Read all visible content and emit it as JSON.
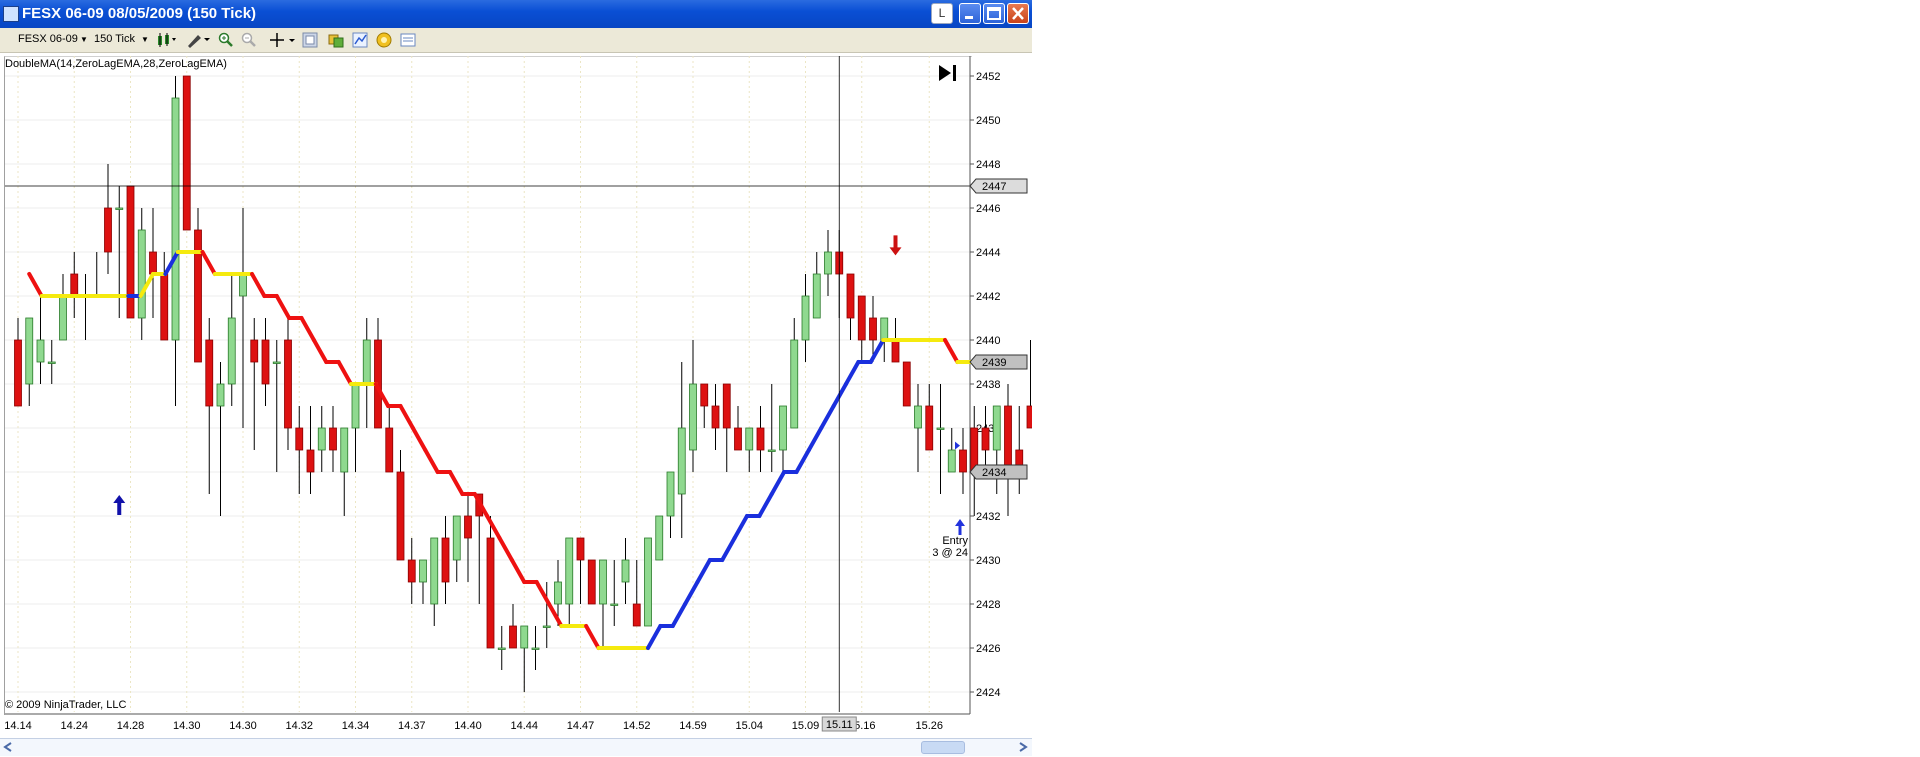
{
  "window": {
    "title": "FESX 06-09  08/05/2009 (150 Tick)",
    "close_tooltip_letter": "L"
  },
  "toolbar": {
    "instrument": "FESX 06-09",
    "interval": "150 Tick",
    "icons": [
      "candlestick-style-icon",
      "draw-tool-icon",
      "zoom-in-icon",
      "zoom-out-icon",
      "crosshair-icon",
      "properties-icon",
      "strategies-icon",
      "indicators-icon",
      "data-box-icon",
      "chart-properties-icon"
    ]
  },
  "chart": {
    "indicator_label": "DoubleMA(14,ZeroLagEMA,28,ZeroLagEMA)",
    "copyright": "© 2009 NinjaTrader, LLC",
    "crosshair_price_label": "2447",
    "last_price_label": "2439",
    "marker_price_label": "2434",
    "entry_label_1": "Entry",
    "entry_label_2": "3 @ 24",
    "crosshair_time_label": "15.11",
    "colors": {
      "up": "#8fd98f",
      "down": "#dd1111",
      "ma_down": "#ee1111",
      "ma_flat": "#f5ea0e",
      "ma_up": "#1a2fdd",
      "arrow_buy": "#1111aa",
      "arrow_sell": "#cc1111"
    }
  },
  "chart_data": {
    "type": "candlestick",
    "title": "",
    "ylim": [
      2423.5,
      2453
    ],
    "y_ticks": [
      2424,
      2426,
      2428,
      2430,
      2432,
      2434,
      2436,
      2438,
      2440,
      2442,
      2444,
      2446,
      2448,
      2450,
      2452
    ],
    "x_ticks": [
      "14.14",
      "14.24",
      "14.28",
      "14.30",
      "14.30",
      "14.32",
      "14.34",
      "14.37",
      "14.40",
      "14.44",
      "14.47",
      "14.52",
      "14.59",
      "15.04",
      "15.09",
      "15.16",
      "15.26"
    ],
    "x_tick_bar_index": [
      0,
      5,
      10,
      15,
      20,
      25,
      30,
      35,
      40,
      45,
      50,
      55,
      60,
      65,
      70,
      75,
      81
    ],
    "candles": [
      [
        2440,
        2441,
        2437,
        2437
      ],
      [
        2438,
        2441,
        2437,
        2441
      ],
      [
        2439,
        2442,
        2438,
        2440
      ],
      [
        2439,
        2440,
        2438,
        2439
      ],
      [
        2440,
        2443,
        2440,
        2442
      ],
      [
        2443,
        2444,
        2441,
        2442
      ],
      [
        2442,
        2443,
        2440,
        2442
      ],
      [
        2442,
        2444,
        2442,
        2442
      ],
      [
        2446,
        2448,
        2443,
        2444
      ],
      [
        2446,
        2447,
        2441,
        2446
      ],
      [
        2447,
        2447,
        2441,
        2441
      ],
      [
        2441,
        2446,
        2440,
        2445
      ],
      [
        2444,
        2446,
        2441,
        2443
      ],
      [
        2443,
        2444,
        2440,
        2440
      ],
      [
        2440,
        2452,
        2437,
        2451
      ],
      [
        2452,
        2452,
        2445,
        2445
      ],
      [
        2445,
        2446,
        2439,
        2439
      ],
      [
        2440,
        2441,
        2433,
        2437
      ],
      [
        2437,
        2439,
        2432,
        2438
      ],
      [
        2438,
        2443,
        2437,
        2441
      ],
      [
        2442,
        2446,
        2436,
        2443
      ],
      [
        2440,
        2441,
        2435,
        2439
      ],
      [
        2440,
        2441,
        2437,
        2438
      ],
      [
        2439,
        2440,
        2434,
        2439
      ],
      [
        2440,
        2441,
        2435,
        2436
      ],
      [
        2436,
        2437,
        2433,
        2435
      ],
      [
        2435,
        2437,
        2433,
        2434
      ],
      [
        2435,
        2437,
        2434,
        2436
      ],
      [
        2436,
        2437,
        2434,
        2435
      ],
      [
        2434,
        2436,
        2432,
        2436
      ],
      [
        2436,
        2438,
        2434,
        2438
      ],
      [
        2438,
        2441,
        2436,
        2440
      ],
      [
        2440,
        2441,
        2436,
        2436
      ],
      [
        2436,
        2437,
        2434,
        2434
      ],
      [
        2434,
        2435,
        2430,
        2430
      ],
      [
        2430,
        2431,
        2428,
        2429
      ],
      [
        2429,
        2430,
        2428,
        2430
      ],
      [
        2428,
        2431,
        2427,
        2431
      ],
      [
        2431,
        2432,
        2428,
        2429
      ],
      [
        2430,
        2432,
        2429,
        2432
      ],
      [
        2432,
        2433,
        2429,
        2431
      ],
      [
        2433,
        2433,
        2428,
        2432
      ],
      [
        2431,
        2432,
        2426,
        2426
      ],
      [
        2426,
        2427,
        2425,
        2426
      ],
      [
        2427,
        2428,
        2426,
        2426
      ],
      [
        2426,
        2427,
        2424,
        2427
      ],
      [
        2426,
        2427,
        2425,
        2426
      ],
      [
        2427,
        2429,
        2426,
        2427
      ],
      [
        2428,
        2430,
        2427,
        2429
      ],
      [
        2428,
        2431,
        2427,
        2431
      ],
      [
        2431,
        2431,
        2428,
        2430
      ],
      [
        2430,
        2430,
        2428,
        2428
      ],
      [
        2428,
        2430,
        2426,
        2430
      ],
      [
        2428,
        2430,
        2427,
        2428
      ],
      [
        2429,
        2431,
        2428,
        2430
      ],
      [
        2428,
        2430,
        2427,
        2427
      ],
      [
        2427,
        2431,
        2427,
        2431
      ],
      [
        2430,
        2432,
        2430,
        2432
      ],
      [
        2432,
        2434,
        2431,
        2434
      ],
      [
        2433,
        2439,
        2431,
        2436
      ],
      [
        2435,
        2440,
        2434,
        2438
      ],
      [
        2438,
        2438,
        2436,
        2437
      ],
      [
        2437,
        2438,
        2435,
        2436
      ],
      [
        2438,
        2438,
        2434,
        2436
      ],
      [
        2436,
        2437,
        2435,
        2435
      ],
      [
        2435,
        2436,
        2434,
        2436
      ],
      [
        2436,
        2437,
        2434,
        2435
      ],
      [
        2435,
        2438,
        2434,
        2435
      ],
      [
        2435,
        2437,
        2434,
        2437
      ],
      [
        2436,
        2441,
        2436,
        2440
      ],
      [
        2440,
        2443,
        2439,
        2442
      ],
      [
        2441,
        2444,
        2441,
        2443
      ],
      [
        2443,
        2445,
        2442,
        2444
      ],
      [
        2444,
        2445,
        2441,
        2443
      ],
      [
        2443,
        2443,
        2440,
        2441
      ],
      [
        2442,
        2442,
        2439,
        2440
      ],
      [
        2441,
        2442,
        2439,
        2440
      ],
      [
        2440,
        2441,
        2439,
        2441
      ],
      [
        2440,
        2441,
        2439,
        2439
      ],
      [
        2439,
        2439,
        2437,
        2437
      ],
      [
        2436,
        2438,
        2434,
        2437
      ],
      [
        2437,
        2438,
        2435,
        2435
      ],
      [
        2436,
        2438,
        2433,
        2436
      ],
      [
        2434,
        2436,
        2434,
        2435
      ],
      [
        2435,
        2436,
        2433,
        2434
      ],
      [
        2436,
        2437,
        2432,
        2434
      ],
      [
        2436,
        2437,
        2434,
        2435
      ],
      [
        2435,
        2437,
        2433,
        2437
      ],
      [
        2437,
        2438,
        2432,
        2434
      ],
      [
        2435,
        2437,
        2433,
        2434
      ],
      [
        2437,
        2440,
        2436,
        2436
      ],
      [
        2438,
        2439,
        2433,
        2434
      ]
    ],
    "ma_points": [
      [
        2443,
        "down"
      ],
      [
        2442,
        "down"
      ],
      [
        2442,
        "flat"
      ],
      [
        2442,
        "flat"
      ],
      [
        2442,
        "flat"
      ],
      [
        2442,
        "flat"
      ],
      [
        2442,
        "flat"
      ],
      [
        2442,
        "flat"
      ],
      [
        2442,
        "flat"
      ],
      [
        2442,
        "up"
      ],
      [
        2443,
        "flat"
      ],
      [
        2443,
        "flat"
      ],
      [
        2444,
        "up"
      ],
      [
        2444,
        "flat"
      ],
      [
        2444,
        "flat"
      ],
      [
        2443,
        "down"
      ],
      [
        2443,
        "flat"
      ],
      [
        2443,
        "flat"
      ],
      [
        2443,
        "flat"
      ],
      [
        2442,
        "down"
      ],
      [
        2442,
        "down"
      ],
      [
        2441,
        "down"
      ],
      [
        2441,
        "down"
      ],
      [
        2440,
        "down"
      ],
      [
        2439,
        "down"
      ],
      [
        2439,
        "down"
      ],
      [
        2438,
        "down"
      ],
      [
        2438,
        "flat"
      ],
      [
        2438,
        "flat"
      ],
      [
        2437,
        "down"
      ],
      [
        2437,
        "down"
      ],
      [
        2436,
        "down"
      ],
      [
        2435,
        "down"
      ],
      [
        2434,
        "down"
      ],
      [
        2434,
        "down"
      ],
      [
        2433,
        "down"
      ],
      [
        2433,
        "down"
      ],
      [
        2432,
        "down"
      ],
      [
        2431,
        "down"
      ],
      [
        2430,
        "down"
      ],
      [
        2429,
        "down"
      ],
      [
        2429,
        "down"
      ],
      [
        2428,
        "down"
      ],
      [
        2427,
        "down"
      ],
      [
        2427,
        "flat"
      ],
      [
        2427,
        "flat"
      ],
      [
        2426,
        "down"
      ],
      [
        2426,
        "flat"
      ],
      [
        2426,
        "flat"
      ],
      [
        2426,
        "flat"
      ],
      [
        2426,
        "flat"
      ],
      [
        2427,
        "up"
      ],
      [
        2427,
        "up"
      ],
      [
        2428,
        "up"
      ],
      [
        2429,
        "up"
      ],
      [
        2430,
        "up"
      ],
      [
        2430,
        "up"
      ],
      [
        2431,
        "up"
      ],
      [
        2432,
        "up"
      ],
      [
        2432,
        "up"
      ],
      [
        2433,
        "up"
      ],
      [
        2434,
        "up"
      ],
      [
        2434,
        "up"
      ],
      [
        2435,
        "up"
      ],
      [
        2436,
        "up"
      ],
      [
        2437,
        "up"
      ],
      [
        2438,
        "up"
      ],
      [
        2439,
        "up"
      ],
      [
        2439,
        "up"
      ],
      [
        2440,
        "up"
      ],
      [
        2440,
        "flat"
      ],
      [
        2440,
        "flat"
      ],
      [
        2440,
        "flat"
      ],
      [
        2440,
        "flat"
      ],
      [
        2440,
        "flat"
      ],
      [
        2439,
        "down"
      ],
      [
        2439,
        "flat"
      ],
      [
        2439,
        "flat"
      ],
      [
        2439,
        "flat"
      ]
    ],
    "ma_start_bar": 1,
    "ma_x_scale": 1.1,
    "buy_arrow": {
      "bar": 9,
      "price": 2432.5
    },
    "sell_arrow": {
      "bar": 78,
      "price": 2444.3
    },
    "entry_arrow": {
      "price": 2431.5
    },
    "crosshair": {
      "price": 2447,
      "bar": 73
    }
  }
}
